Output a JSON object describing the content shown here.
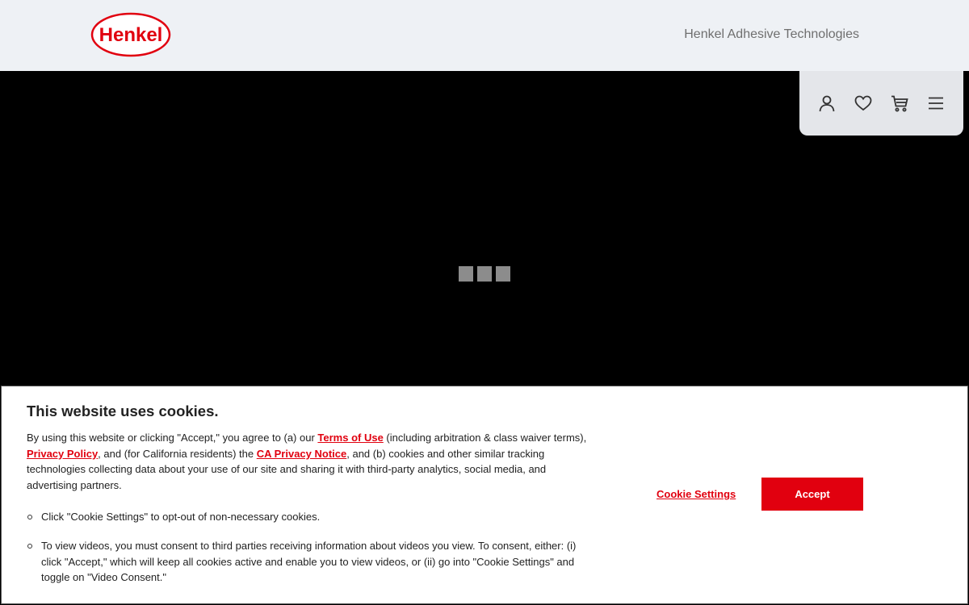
{
  "header": {
    "logo_text": "Henkel",
    "site_title": "Henkel Adhesive Technologies"
  },
  "toolbar": {
    "icons": [
      "user-icon",
      "heart-icon",
      "cart-icon",
      "menu-icon"
    ]
  },
  "colors": {
    "brand_red": "#e1000f",
    "header_bg": "#eef1f5",
    "toolbar_bg": "#e4e6ea"
  },
  "cookie": {
    "title": "This website uses cookies.",
    "p1_a": "By using this website or clicking \"Accept,\" you agree to (a) our ",
    "terms_link": "Terms of Use",
    "p1_b": " (including arbitration & class waiver terms), ",
    "privacy_link": "Privacy Policy",
    "p1_c": ", and (for California residents) the ",
    "ca_link": "CA Privacy Notice",
    "p1_d": ", and (b) cookies and other similar tracking technologies collecting data about your use of our site and sharing it with third-party analytics, social media, and advertising partners.",
    "bullet1": "Click \"Cookie Settings\" to opt-out of non-necessary cookies.",
    "bullet2": "To view videos, you must consent to third parties receiving information about videos you view. To consent, either: (i) click \"Accept,\" which will keep all cookies active and enable you to view videos, or (ii) go into \"Cookie Settings\" and toggle on \"Video Consent.\"",
    "settings_label": "Cookie Settings",
    "accept_label": "Accept"
  }
}
